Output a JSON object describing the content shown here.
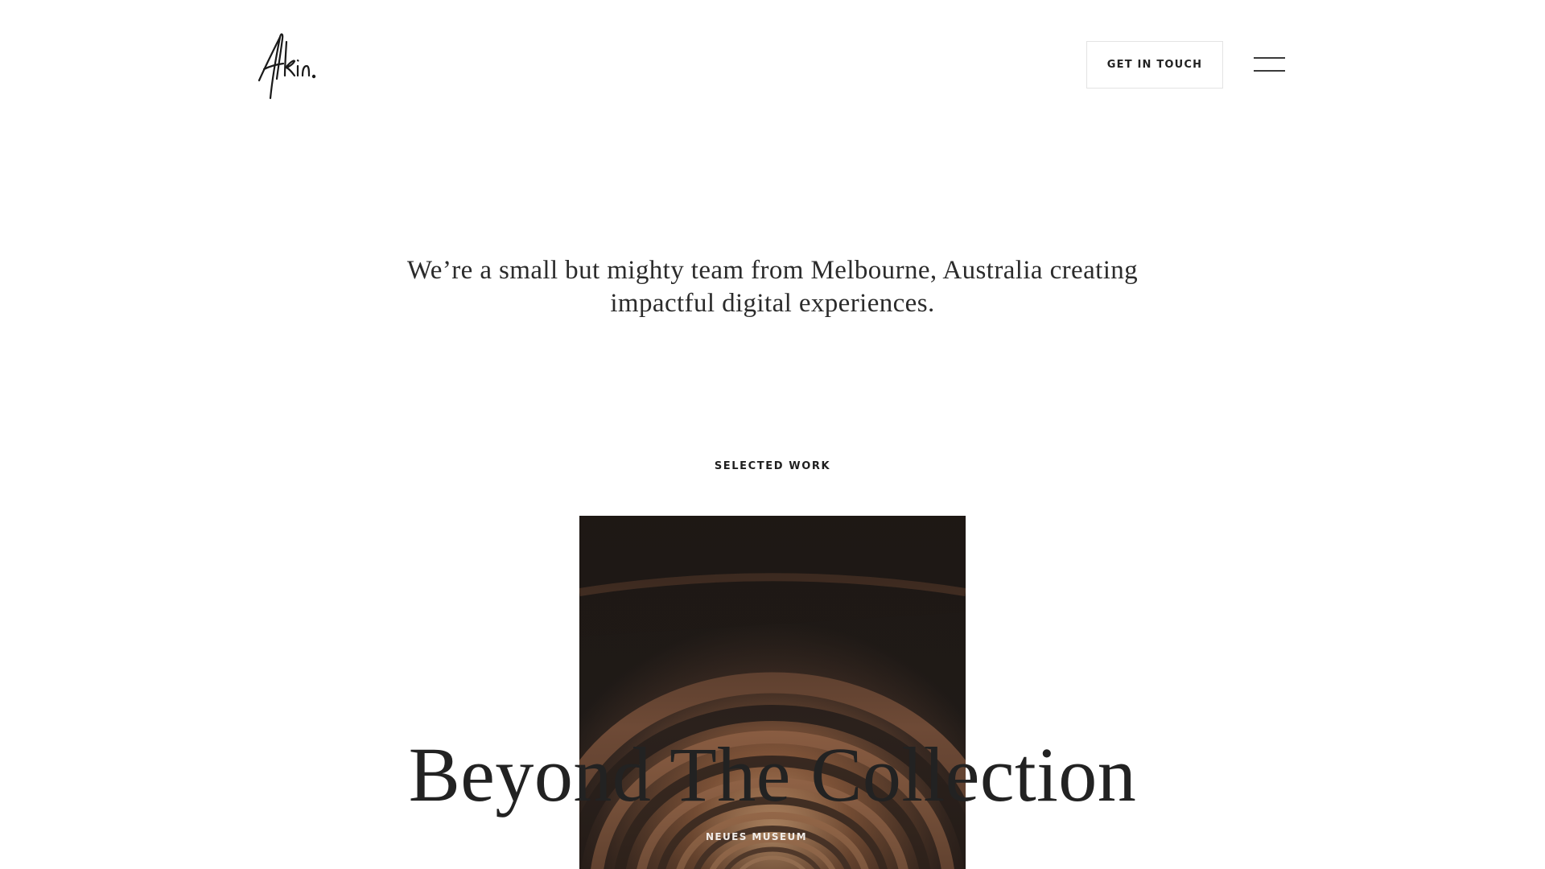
{
  "header": {
    "logo_text": "Akin.",
    "cta_label": "GET IN TOUCH",
    "menu_icon": "hamburger-menu-icon"
  },
  "intro": {
    "text": "We’re a small but mighty team from Melbourne, Australia creating impactful digital experiences."
  },
  "selected_work": {
    "label": "SELECTED WORK",
    "projects": [
      {
        "title": "Beyond The Collection",
        "client": "NEUES MUSEUM",
        "image_subject": "arched brick corridor"
      }
    ]
  },
  "colors": {
    "background": "#ffffff",
    "text": "#222222",
    "button_border": "#e3e3e3",
    "image_dark": "#231b17",
    "image_warm": "#b07a55"
  }
}
